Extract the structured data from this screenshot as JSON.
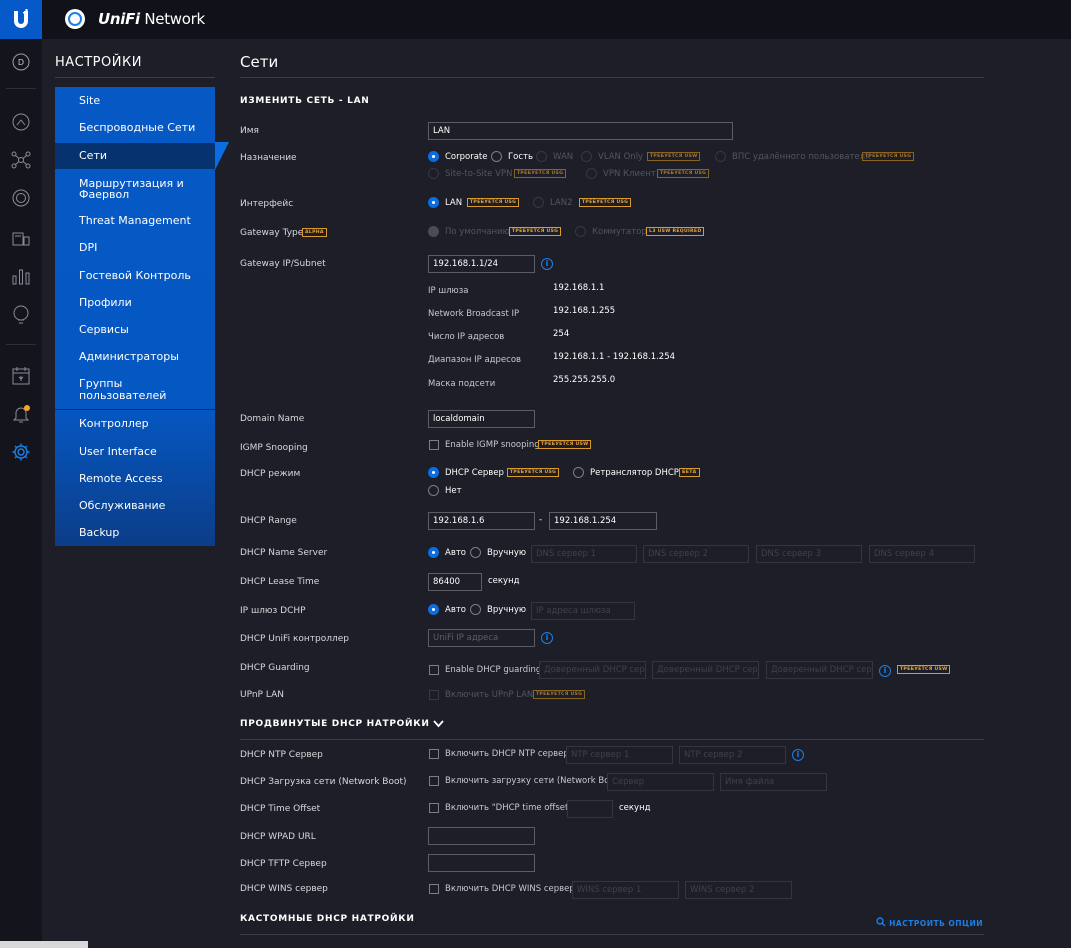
{
  "header": {
    "brand_prefix": "UniFi",
    "brand_suffix": "Network"
  },
  "rail": {
    "site_initial": "D"
  },
  "settings": {
    "title": "НАСТРОЙКИ",
    "items": [
      "Site",
      "Беспроводные Сети",
      "Сети",
      "Маршрутизация и",
      "Фаервол",
      "Threat Management",
      "DPI",
      "Гостевой Контроль",
      "Профили",
      "Сервисы",
      "Администраторы",
      "Группы",
      "пользователей",
      "Контроллер",
      "User Interface",
      "Remote Access",
      "Обслуживание",
      "Backup"
    ]
  },
  "page": {
    "title": "Сети",
    "section_edit": "ИЗМЕНИТЬ СЕТЬ - LAN",
    "section_adv": "ПРОДВИНУТЫЕ DHCP НАТРОЙКИ",
    "section_custom": "КАСТОМНЫЕ DHCP НАТРОЙКИ",
    "custom_link": "НАСТРОИТЬ ОПЦИИ"
  },
  "badges": {
    "usg": "ТРЕБУЕТСЯ USG",
    "usw": "ТРЕБУЕТСЯ USW",
    "alpha": "ALPHA",
    "beta": "БЕТА",
    "l3": "L3 USW REQUIRED"
  },
  "form": {
    "name": {
      "label": "Имя",
      "value": "LAN"
    },
    "purpose": {
      "label": "Назначение",
      "options": [
        "Corporate",
        "Гость",
        "WAN",
        "VLAN Only",
        "ВПС удалённого пользователя",
        "Site-to-Site VPN",
        "VPN Клиент"
      ]
    },
    "interface": {
      "label": "Интерфейс",
      "options": [
        "LAN",
        "LAN2"
      ]
    },
    "gateway_type": {
      "label": "Gateway Type",
      "options": [
        "По умолчанию",
        "Коммутатор"
      ]
    },
    "gateway_ip": {
      "label": "Gateway IP/Subnet",
      "value": "192.168.1.1/24"
    },
    "info_rows": [
      {
        "k": "IP шлюза",
        "v": "192.168.1.1"
      },
      {
        "k": "Network Broadcast IP",
        "v": "192.168.1.255"
      },
      {
        "k": "Число IP адресов",
        "v": "254"
      },
      {
        "k": "Диапазон IP адресов",
        "v": "192.168.1.1 - 192.168.1.254"
      },
      {
        "k": "Маска подсети",
        "v": "255.255.255.0"
      }
    ],
    "domain": {
      "label": "Domain Name",
      "value": "localdomain"
    },
    "igmp": {
      "label": "IGMP Snooping",
      "text": "Enable IGMP snooping"
    },
    "dhcp_mode": {
      "label": "DHCP режим",
      "options": [
        "DHCP Сервер",
        "Ретранслятор DHCP",
        "Нет"
      ]
    },
    "dhcp_range": {
      "label": "DHCP Range",
      "start": "192.168.1.6",
      "sep": "-",
      "end": "192.168.1.254"
    },
    "dns": {
      "label": "DHCP Name Server",
      "auto": "Авто",
      "manual": "Вручную",
      "ph": [
        "DNS сервер 1",
        "DNS сервер 2",
        "DNS сервер 3",
        "DNS сервер 4"
      ]
    },
    "lease": {
      "label": "DHCP Lease Time",
      "value": "86400",
      "unit": "секунд"
    },
    "gw": {
      "label": "IP шлюз DCHP",
      "auto": "Авто",
      "manual": "Вручную",
      "ph": "IP адреса шлюза"
    },
    "unifi": {
      "label": "DHCP UniFi контроллер",
      "ph": "UniFi IP адреса"
    },
    "guard": {
      "label": "DHCP Guarding",
      "text": "Enable DHCP guarding",
      "ph": [
        "Доверенный DHCP серв",
        "Доверенный DHCP серв",
        "Доверенный DHCP серв"
      ]
    },
    "upnp": {
      "label": "UPnP LAN",
      "text": "Включить UPnP LAN"
    },
    "ntp": {
      "label": "DHCP NTP Сервер",
      "text": "Включить DHCP NTP сервер",
      "ph": [
        "NTP сервер 1",
        "NTP сервер 2"
      ]
    },
    "boot": {
      "label": "DHCP Загрузка сети (Network Boot)",
      "text": "Включить загрузку сети (Network Boot)",
      "ph": [
        "Сервер",
        "Имя файла"
      ]
    },
    "offset": {
      "label": "DHCP Time Offset",
      "text": "Включить \"DHCP time offset\"",
      "unit": "секунд"
    },
    "wpad": {
      "label": "DHCP WPAD URL"
    },
    "tftp": {
      "label": "DHCP TFTP Сервер"
    },
    "wins": {
      "label": "DHCP WINS сервер",
      "text": "Включить DHCP WINS сервер",
      "ph": [
        "WINS сервер 1",
        "WINS сервер 2"
      ]
    }
  }
}
